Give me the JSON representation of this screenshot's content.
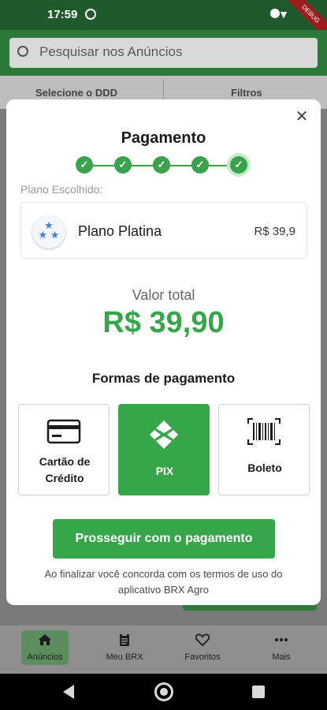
{
  "status_bar": {
    "time": "17:59",
    "debug_banner": "DEBUG"
  },
  "background": {
    "search_placeholder": "Pesquisar nos Anúncios",
    "filter_ddd": "Selecione o DDD",
    "filter_filters": "Filtros"
  },
  "bottom_nav": {
    "items": [
      {
        "label": "Anúncios",
        "icon": "home-icon",
        "active": true
      },
      {
        "label": "Meu BRX",
        "icon": "clipboard-icon",
        "active": false
      },
      {
        "label": "Favoritos",
        "icon": "heart-icon",
        "active": false
      },
      {
        "label": "Mais",
        "icon": "more-icon",
        "active": false
      }
    ]
  },
  "modal": {
    "title": "Pagamento",
    "close_icon": "close-icon",
    "steps": [
      {
        "state": "done"
      },
      {
        "state": "done"
      },
      {
        "state": "done"
      },
      {
        "state": "done"
      },
      {
        "state": "current"
      }
    ],
    "plan_caption": "Plano Escolhido:",
    "plan": {
      "name": "Plano Platina",
      "price": "R$ 39,9",
      "icon": "stars-icon"
    },
    "total_label": "Valor total",
    "total_value": "R$ 39,90",
    "payment_title": "Formas de pagamento",
    "payment_methods": [
      {
        "label_line1": "Cartão de",
        "label_line2": "Crédito",
        "icon": "credit-card-icon",
        "selected": false
      },
      {
        "label_line1": "PIX",
        "icon": "pix-icon",
        "selected": true
      },
      {
        "label_line1": "Boleto",
        "icon": "barcode-icon",
        "selected": false
      }
    ],
    "proceed_label": "Prosseguir com o pagamento",
    "terms_line1": "Ao finalizar você concorda com os termos de uso do",
    "terms_line2": "aplicativo BRX Agro"
  },
  "colors": {
    "accent": "#37a64a",
    "appbar": "#2b7a3b"
  }
}
